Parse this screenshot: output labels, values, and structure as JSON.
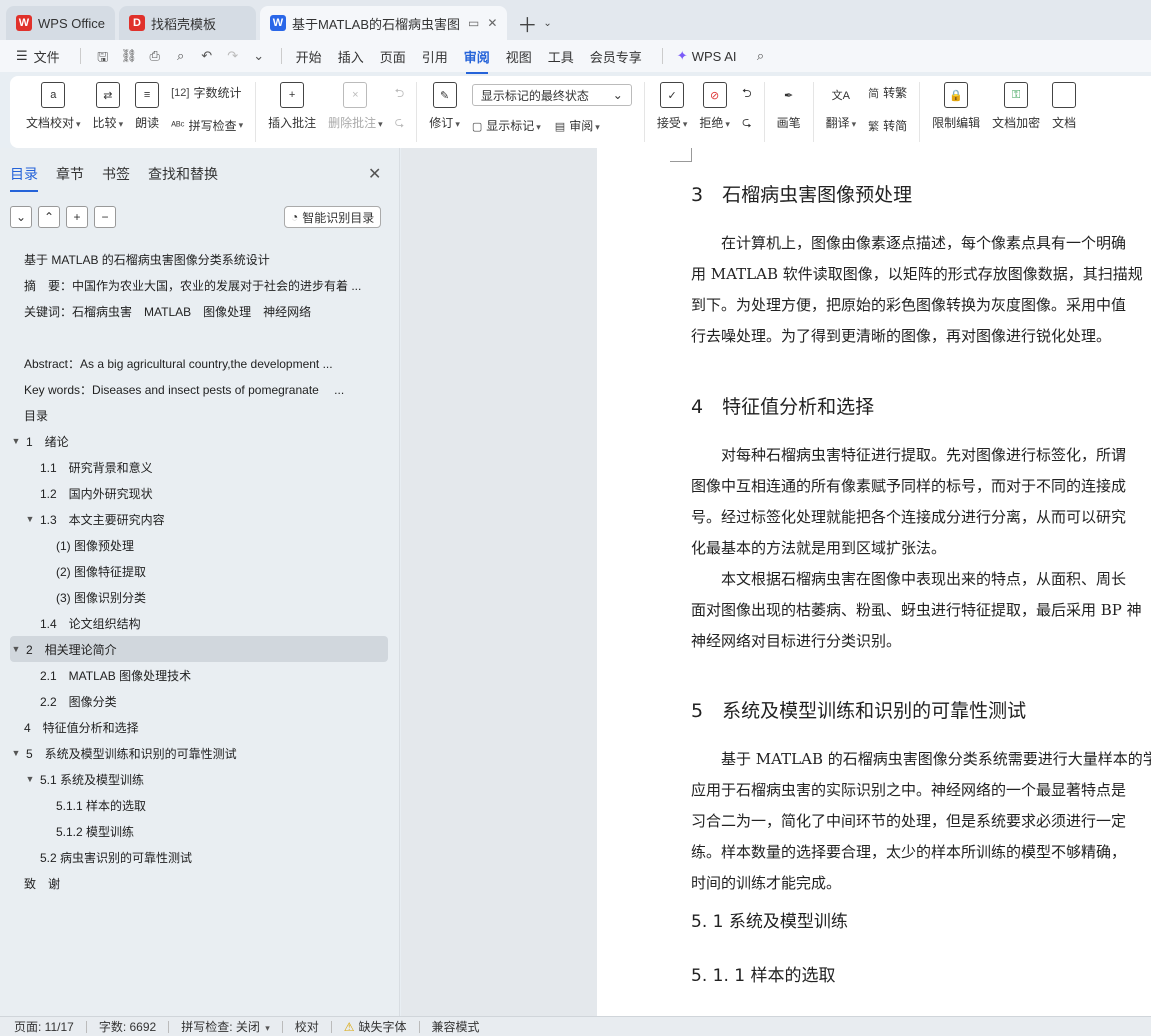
{
  "tabs": [
    {
      "label": "WPS Office",
      "logo": "W",
      "color": "#e0312b"
    },
    {
      "label": "找稻壳模板",
      "logo": "D",
      "color": "#e0312b"
    },
    {
      "label": "基于MATLAB的石榴病虫害图像分类系统设计",
      "logo": "W",
      "color": "#2a67e8"
    }
  ],
  "menu": {
    "file": "文件",
    "items": [
      "开始",
      "插入",
      "页面",
      "引用",
      "审阅",
      "视图",
      "工具",
      "会员专享"
    ],
    "active": "审阅",
    "ai": "WPS AI"
  },
  "ribbon": {
    "doc_check": "文档校对",
    "compare": "比较",
    "read_aloud": "朗读",
    "word_count": "字数统计",
    "spell_check": "拼写检查",
    "insert_comment": "插入批注",
    "delete_comment": "删除批注",
    "revise": "修订",
    "markup_select": "显示标记的最终状态",
    "show_markup": "显示标记",
    "review": "审阅",
    "accept": "接受",
    "reject": "拒绝",
    "pen": "画笔",
    "translate": "翻译",
    "to_trad": "转繁",
    "to_simp": "转简",
    "restrict_edit": "限制编辑",
    "doc_encrypt": "文档加密",
    "doc_more": "文档"
  },
  "nav": {
    "tabs": [
      "目录",
      "章节",
      "书签",
      "查找和替换"
    ],
    "smart_btn": "智能识别目录",
    "toc": [
      {
        "label": "基于 MATLAB 的石榴病虫害图像分类系统设计",
        "level": 0,
        "arrow": ""
      },
      {
        "label": "摘　要：中国作为农业大国，农业的发展对于社会的进步有着 ...",
        "level": 0,
        "arrow": ""
      },
      {
        "label": "关键词：石榴病虫害　MATLAB　图像处理　神经网络",
        "level": 0,
        "arrow": ""
      },
      {
        "label": "",
        "level": 0,
        "arrow": "",
        "gap": true
      },
      {
        "label": "Abstract：As a big agricultural country,the development ...",
        "level": 0,
        "arrow": ""
      },
      {
        "label": "Key words：Diseases and insect pests of pomegranate　 ...",
        "level": 0,
        "arrow": ""
      },
      {
        "label": "目录",
        "level": 0,
        "arrow": ""
      },
      {
        "label": "1　绪论",
        "level": 0,
        "arrow": "▼"
      },
      {
        "label": "1.1　研究背景和意义",
        "level": 1,
        "arrow": ""
      },
      {
        "label": "1.2　国内外研究现状",
        "level": 1,
        "arrow": ""
      },
      {
        "label": "1.3　本文主要研究内容",
        "level": 1,
        "arrow": "▼"
      },
      {
        "label": "(1) 图像预处理",
        "level": 2,
        "arrow": ""
      },
      {
        "label": "(2) 图像特征提取",
        "level": 2,
        "arrow": ""
      },
      {
        "label": "(3) 图像识别分类",
        "level": 2,
        "arrow": ""
      },
      {
        "label": "1.4　论文组织结构",
        "level": 1,
        "arrow": ""
      },
      {
        "label": "2　相关理论简介",
        "level": 0,
        "arrow": "▼",
        "selected": true
      },
      {
        "label": "2.1　MATLAB 图像处理技术",
        "level": 1,
        "arrow": ""
      },
      {
        "label": "2.2　图像分类",
        "level": 1,
        "arrow": ""
      },
      {
        "label": "4　特征值分析和选择",
        "level": 0,
        "arrow": ""
      },
      {
        "label": "5　系统及模型训练和识别的可靠性测试",
        "level": 0,
        "arrow": "▼"
      },
      {
        "label": "5.1 系统及模型训练",
        "level": 1,
        "arrow": "▼"
      },
      {
        "label": "5.1.1 样本的选取",
        "level": 2,
        "arrow": ""
      },
      {
        "label": "5.1.2 模型训练",
        "level": 2,
        "arrow": ""
      },
      {
        "label": "5.2 病虫害识别的可靠性测试",
        "level": 1,
        "arrow": ""
      },
      {
        "label": "致　谢",
        "level": 0,
        "arrow": ""
      }
    ]
  },
  "doc": {
    "h_3": "3　石榴病虫害图像预处理",
    "p_3": [
      "　　在计算机上，图像由像素逐点描述，每个像素点具有一个明确",
      "用 MATLAB 软件读取图像，以矩阵的形式存放图像数据，其扫描规",
      "到下。为处理方便，把原始的彩色图像转换为灰度图像。采用中值",
      "行去噪处理。为了得到更清晰的图像，再对图像进行锐化处理。"
    ],
    "h_4": "4　特征值分析和选择",
    "p_4": [
      "　　对每种石榴病虫害特征进行提取。先对图像进行标签化，所谓",
      "图像中互相连通的所有像素赋予同样的标号，而对于不同的连接成",
      "号。经过标签化处理就能把各个连接成分进行分离，从而可以研究",
      "化最基本的方法就是用到区域扩张法。",
      "　　本文根据石榴病虫害在图像中表现出来的特点，从面积、周长",
      "面对图像出现的枯萎病、粉虱、蚜虫进行特征提取，最后采用 BP 神",
      "神经网络对目标进行分类识别。"
    ],
    "h_5": "5　系统及模型训练和识别的可靠性测试",
    "p_5": [
      "　　基于 MATLAB 的石榴病虫害图像分类系统需要进行大量样本的学",
      "应用于石榴病虫害的实际识别之中。神经网络的一个最显著特点是",
      "习合二为一，简化了中间环节的处理，但是系统要求必须进行一定",
      "练。样本数量的选择要合理，太少的样本所训练的模型不够精确，",
      "时间的训练才能完成。"
    ],
    "h_51": "5. 1 系统及模型训练",
    "h_511": "5. 1. 1 样本的选取"
  },
  "status": {
    "page": "页面: 11/17",
    "words": "字数: 6692",
    "spell": "拼写检查: 关闭",
    "proof": "校对",
    "missing_font": "缺失字体",
    "compat": "兼容模式"
  }
}
